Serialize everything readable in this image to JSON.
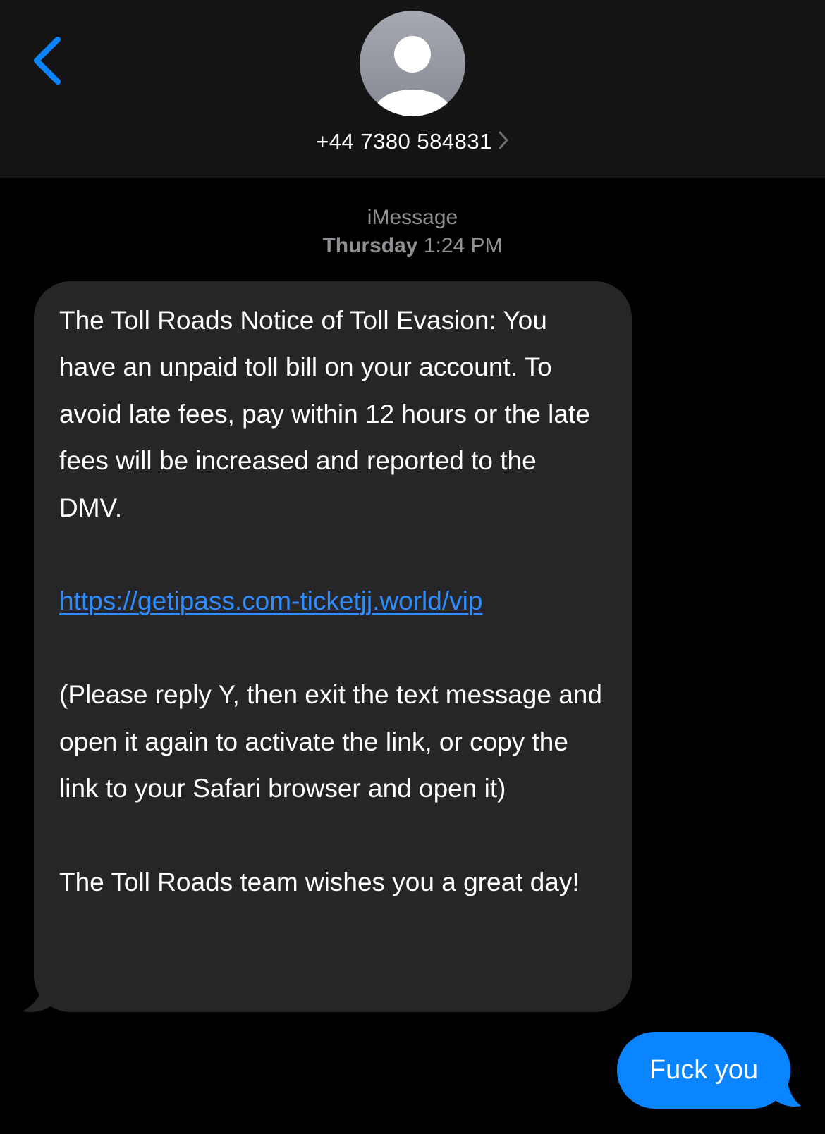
{
  "header": {
    "contact": "+44 7380 584831",
    "back_icon": "chevron-left-icon",
    "avatar_icon": "person-silhouette-icon",
    "contact_chevron_icon": "chevron-right-icon"
  },
  "conversation": {
    "service": "iMessage",
    "day": "Thursday",
    "time": "1:24 PM"
  },
  "incoming_message": {
    "paragraph_1": "The Toll Roads Notice of Toll Evasion: You have an unpaid toll bill on your account. To avoid late fees, pay within 12 hours or the late fees will be increased and reported to the DMV.",
    "link": "https://getipass.com-ticketjj.world/vip",
    "paragraph_2": "(Please reply Y, then exit the text message and open it again to activate the link, or copy the link to your Safari browser and open it)",
    "paragraph_3": "The Toll Roads team wishes you a great day!"
  },
  "outgoing_message": {
    "text": "Fuck you"
  },
  "colors": {
    "accent": "#0a84ff",
    "link": "#2f8cff",
    "incoming_bubble": "#262629",
    "header_background": "#141414",
    "secondary_text": "#8e8e93"
  }
}
